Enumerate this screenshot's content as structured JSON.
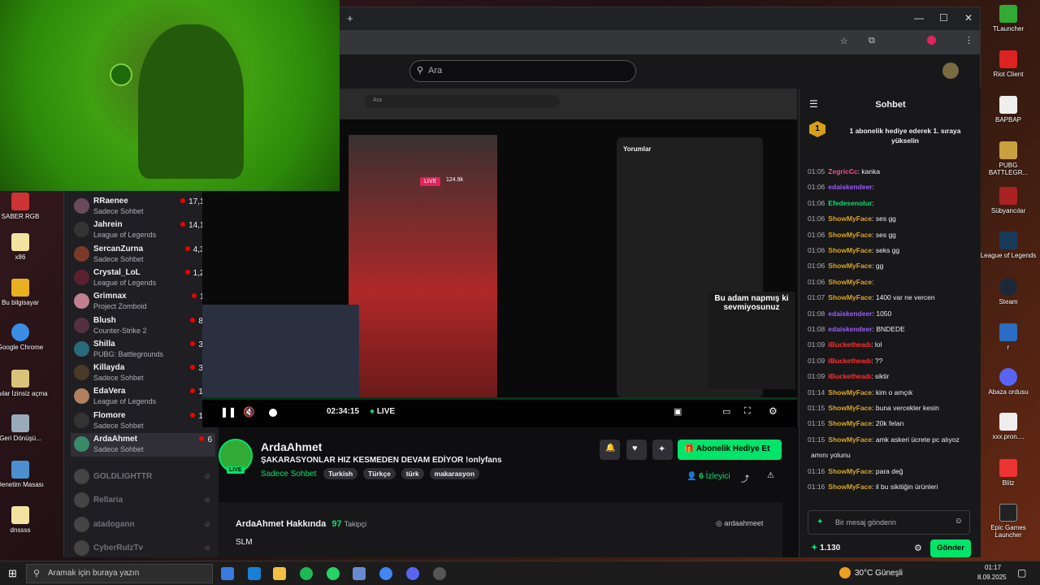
{
  "desktop": {
    "icons": [
      "SABER RGB",
      "x86",
      "Bu bilgisayar",
      "Google Chrome",
      "Anılar İzinsiz açma",
      "Geri Dönüşü...",
      "Denetim Masası",
      "dnssss"
    ],
    "right_icons": [
      "TLauncher",
      "Riot Client",
      "BAPBAP",
      "PUBG BATTLEGR...",
      "Sübyancılar",
      "League of Legends",
      "Steam",
      "r",
      "Abaza ordusu",
      "xxx.pron....",
      "Blitz",
      "Epic Games Launcher"
    ]
  },
  "browser": {
    "new_tab": "+",
    "search_placeholder": "Ara"
  },
  "sidebar": {
    "channels": [
      {
        "name": "RRaenee",
        "cat": "Sadece Sohbet",
        "viewers": "17,1 B"
      },
      {
        "name": "Jahrein",
        "cat": "League of Legends",
        "viewers": "14,1 B"
      },
      {
        "name": "SercanZurna",
        "cat": "Sadece Sohbet",
        "viewers": "4,3 B"
      },
      {
        "name": "Crystal_LoL",
        "cat": "League of Legends",
        "viewers": "1,2 B"
      },
      {
        "name": "Grimnax",
        "cat": "Project Zomboid",
        "viewers": "1 B"
      },
      {
        "name": "Blush",
        "cat": "Counter-Strike 2",
        "viewers": "866"
      },
      {
        "name": "Shilla",
        "cat": "PUBG: Battlegrounds",
        "viewers": "373"
      },
      {
        "name": "Killayda",
        "cat": "Sadece Sohbet",
        "viewers": "302"
      },
      {
        "name": "EdaVera",
        "cat": "League of Legends",
        "viewers": "197"
      },
      {
        "name": "Flomore",
        "cat": "Sadece Sohbet",
        "viewers": "154"
      },
      {
        "name": "ArdaAhmet",
        "cat": "Sadece Sohbet",
        "viewers": "6"
      }
    ],
    "offline": [
      "GOLDLIGHTTR",
      "Rellaria",
      "atadogann",
      "CyberRulzTv"
    ]
  },
  "player": {
    "time": "02:34:15",
    "live": "LIVE",
    "overlay_text": "Bu adam napmış ki sevmiyosunuz",
    "inner_search": "Ara",
    "comments_title": "Yorumlar",
    "live_badge": "LIVE",
    "yt_views": "124.9k"
  },
  "stream": {
    "channel": "ArdaAhmet",
    "title": "ŞAKARASYONLAR HIZ KESMEDEN DEVAM EDİYOR !onlyfans",
    "category": "Sadece Sohbet",
    "tags": [
      "Turkish",
      "Türkçe",
      "türk",
      "makarasyon"
    ],
    "gift_button": "Abonelik Hediye Et",
    "viewers": "6",
    "viewers_label": "İzleyici",
    "live_badge": "LIVE"
  },
  "about": {
    "title": "ArdaAhmet Hakkında",
    "followers": "97",
    "followers_label": "Takipçi",
    "body": "SLM",
    "social": "ardaahmeet"
  },
  "chat": {
    "header": "Sohbet",
    "gift_banner": "1 abonelik hediye ederek 1. sıraya yükselin",
    "gift_rank": "1",
    "messages": [
      {
        "t": "01:05",
        "u": "ZegricCc",
        "c": "#ff4a8a",
        "m": ": kanka"
      },
      {
        "t": "01:06",
        "u": "edaiskendeer",
        "c": "#9b5cff",
        "m": ":"
      },
      {
        "t": "01:06",
        "u": "Efedesenolur",
        "c": "#00e46a",
        "m": ":"
      },
      {
        "t": "01:06",
        "u": "ShowMyFace",
        "c": "#daa520",
        "m": ": ses gg"
      },
      {
        "t": "01:06",
        "u": "ShowMyFace",
        "c": "#daa520",
        "m": ": ses gg"
      },
      {
        "t": "01:06",
        "u": "ShowMyFace",
        "c": "#daa520",
        "m": ": seks gg"
      },
      {
        "t": "01:06",
        "u": "ShowMyFace",
        "c": "#daa520",
        "m": ": gg"
      },
      {
        "t": "01:06",
        "u": "ShowMyFace",
        "c": "#daa520",
        "m": ":"
      },
      {
        "t": "01:07",
        "u": "ShowMyFace",
        "c": "#daa520",
        "m": ": 1400 var ne vercen"
      },
      {
        "t": "01:08",
        "u": "edaiskendeer",
        "c": "#9b5cff",
        "m": ": 1050"
      },
      {
        "t": "01:08",
        "u": "edaiskendeer",
        "c": "#9b5cff",
        "m": ": BNDEDE"
      },
      {
        "t": "01:09",
        "u": "iBucketheadı",
        "c": "#ff3030",
        "m": ": lol"
      },
      {
        "t": "01:09",
        "u": "iBucketheadı",
        "c": "#ff3030",
        "m": ": ??"
      },
      {
        "t": "01:09",
        "u": "iBucketheadı",
        "c": "#ff3030",
        "m": ": siktir"
      },
      {
        "t": "01:14",
        "u": "ShowMyFace",
        "c": "#daa520",
        "m": ": kim o amçık"
      },
      {
        "t": "01:15",
        "u": "ShowMyFace",
        "c": "#daa520",
        "m": ": buna vercekler kesin"
      },
      {
        "t": "01:15",
        "u": "ShowMyFace",
        "c": "#daa520",
        "m": ": 20k felan"
      },
      {
        "t": "01:15",
        "u": "ShowMyFace",
        "c": "#daa520",
        "m": ": amk askeri ücrete pc alıyoz"
      },
      {
        "t": "",
        "u": "",
        "c": "#daa520",
        "m": "amını yolunu"
      },
      {
        "t": "01:16",
        "u": "ShowMyFace",
        "c": "#daa520",
        "m": ": para değ"
      },
      {
        "t": "01:16",
        "u": "ShowMyFace",
        "c": "#daa520",
        "m": ": il bu sikitiğin ürünleri"
      }
    ],
    "input_placeholder": "Bir mesaj gönderin",
    "points": "1.130",
    "send": "Gönder"
  },
  "taskbar": {
    "search": "Aramak için buraya yazın",
    "weather": "30°C Güneşli",
    "time": "01:17",
    "date": "8.09.2025"
  },
  "colors": {
    "accent": "#00e46a",
    "live": "#eb0400"
  }
}
